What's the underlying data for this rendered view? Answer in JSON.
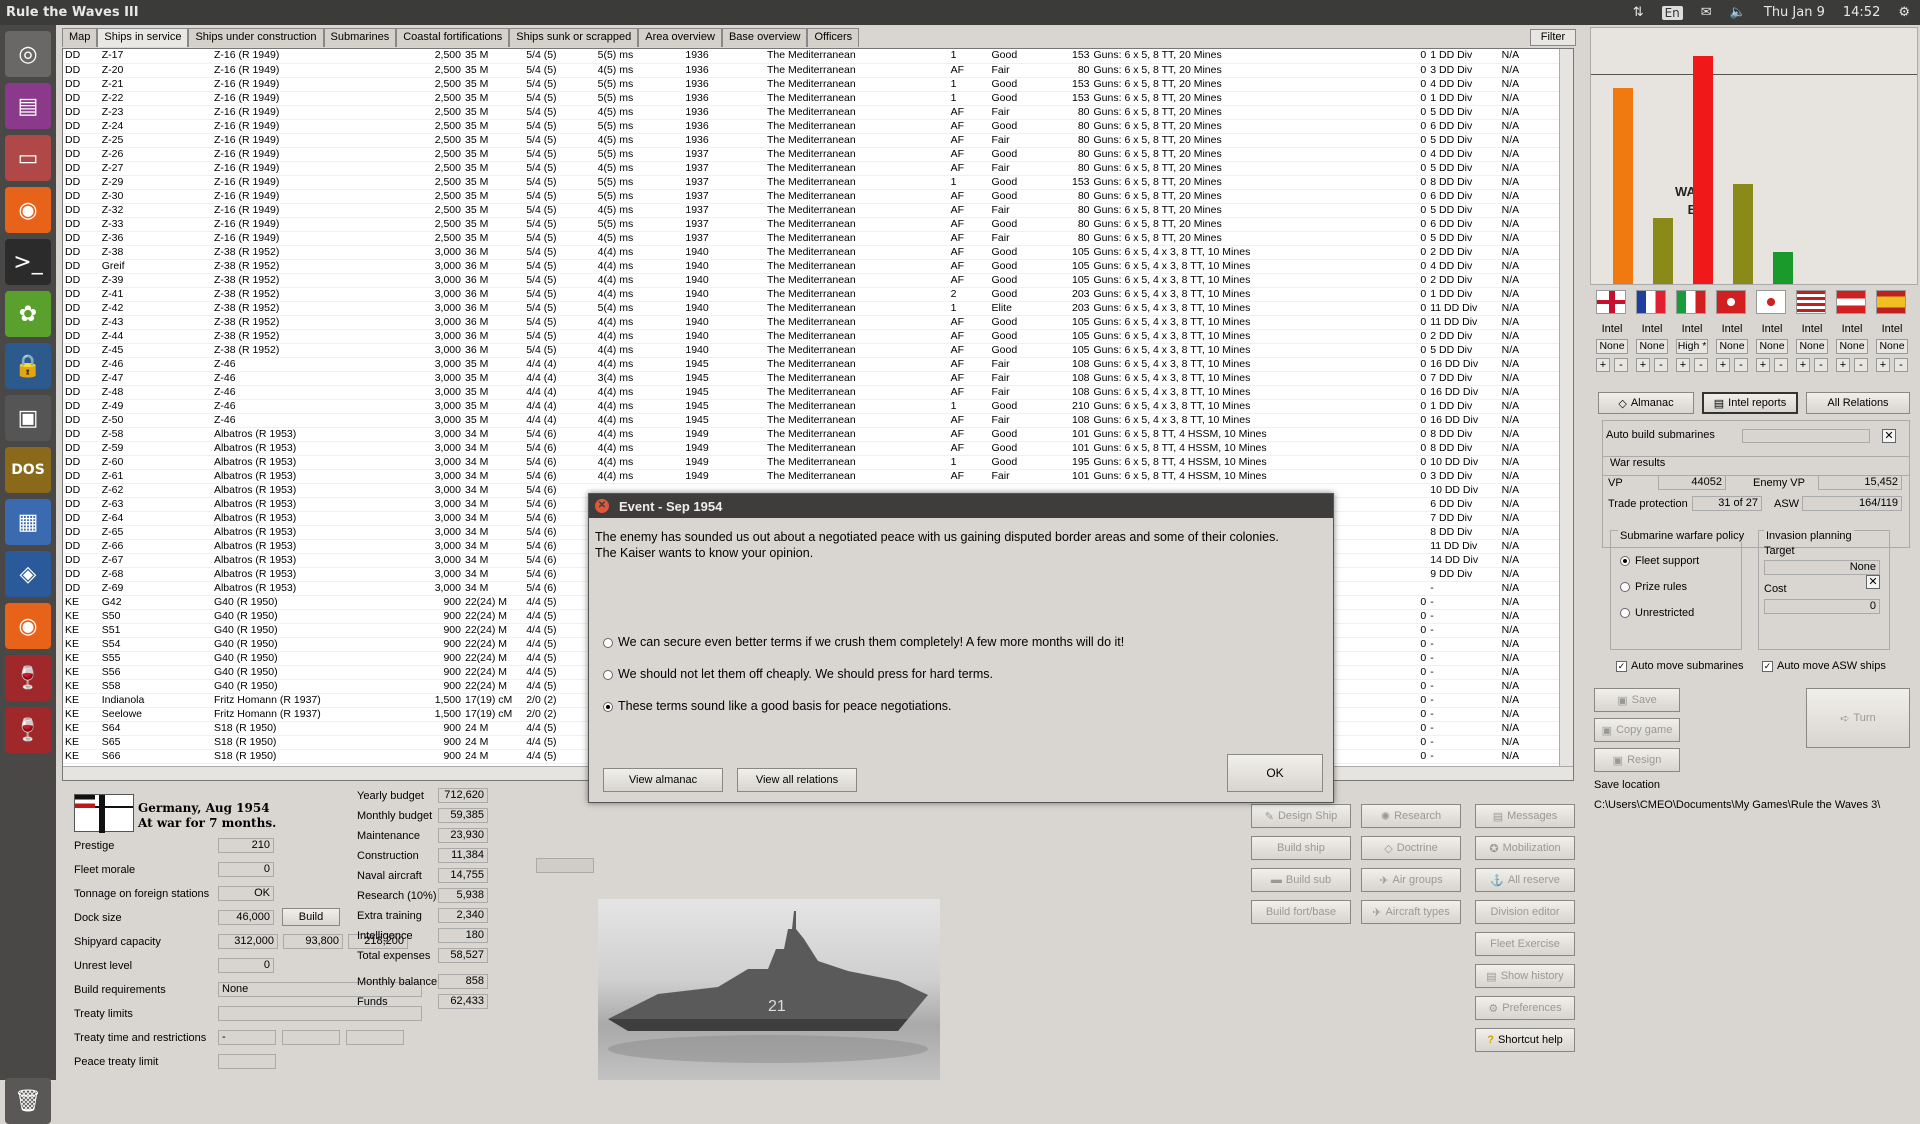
{
  "topbar": {
    "title": "Rule the Waves III",
    "lang": "En",
    "date": "Thu Jan 9",
    "time": "14:52"
  },
  "tabs": [
    "Map",
    "Ships in service",
    "Ships under construction",
    "Submarines",
    "Coastal fortifications",
    "Ships sunk or scrapped",
    "Area overview",
    "Base overview",
    "Officers"
  ],
  "filter_label": "Filter",
  "ships": [
    [
      "DD",
      "Z-17",
      "Z-16 (R 1949)",
      "2,500",
      "35 M",
      "5/4 (5)",
      "5(5) ms",
      "1936",
      "The Mediterranean",
      "1",
      "Good",
      "153",
      "Guns: 6 x 5, 8 TT, 20 Mines",
      "0",
      "1 DD Div",
      "N/A"
    ],
    [
      "DD",
      "Z-20",
      "Z-16 (R 1949)",
      "2,500",
      "35 M",
      "5/4 (5)",
      "4(5) ms",
      "1936",
      "The Mediterranean",
      "AF",
      "Fair",
      "80",
      "Guns: 6 x 5, 8 TT, 20 Mines",
      "0",
      "3 DD Div",
      "N/A"
    ],
    [
      "DD",
      "Z-21",
      "Z-16 (R 1949)",
      "2,500",
      "35 M",
      "5/4 (5)",
      "5(5) ms",
      "1936",
      "The Mediterranean",
      "1",
      "Good",
      "153",
      "Guns: 6 x 5, 8 TT, 20 Mines",
      "0",
      "4 DD Div",
      "N/A"
    ],
    [
      "DD",
      "Z-22",
      "Z-16 (R 1949)",
      "2,500",
      "35 M",
      "5/4 (5)",
      "5(5) ms",
      "1936",
      "The Mediterranean",
      "1",
      "Good",
      "153",
      "Guns: 6 x 5, 8 TT, 20 Mines",
      "0",
      "1 DD Div",
      "N/A"
    ],
    [
      "DD",
      "Z-23",
      "Z-16 (R 1949)",
      "2,500",
      "35 M",
      "5/4 (5)",
      "4(5) ms",
      "1936",
      "The Mediterranean",
      "AF",
      "Fair",
      "80",
      "Guns: 6 x 5, 8 TT, 20 Mines",
      "0",
      "5 DD Div",
      "N/A"
    ],
    [
      "DD",
      "Z-24",
      "Z-16 (R 1949)",
      "2,500",
      "35 M",
      "5/4 (5)",
      "5(5) ms",
      "1936",
      "The Mediterranean",
      "AF",
      "Good",
      "80",
      "Guns: 6 x 5, 8 TT, 20 Mines",
      "0",
      "6 DD Div",
      "N/A"
    ],
    [
      "DD",
      "Z-25",
      "Z-16 (R 1949)",
      "2,500",
      "35 M",
      "5/4 (5)",
      "4(5) ms",
      "1936",
      "The Mediterranean",
      "AF",
      "Fair",
      "80",
      "Guns: 6 x 5, 8 TT, 20 Mines",
      "0",
      "5 DD Div",
      "N/A"
    ],
    [
      "DD",
      "Z-26",
      "Z-16 (R 1949)",
      "2,500",
      "35 M",
      "5/4 (5)",
      "5(5) ms",
      "1937",
      "The Mediterranean",
      "AF",
      "Good",
      "80",
      "Guns: 6 x 5, 8 TT, 20 Mines",
      "0",
      "4 DD Div",
      "N/A"
    ],
    [
      "DD",
      "Z-27",
      "Z-16 (R 1949)",
      "2,500",
      "35 M",
      "5/4 (5)",
      "4(5) ms",
      "1937",
      "The Mediterranean",
      "AF",
      "Fair",
      "80",
      "Guns: 6 x 5, 8 TT, 20 Mines",
      "0",
      "5 DD Div",
      "N/A"
    ],
    [
      "DD",
      "Z-29",
      "Z-16 (R 1949)",
      "2,500",
      "35 M",
      "5/4 (5)",
      "5(5) ms",
      "1937",
      "The Mediterranean",
      "1",
      "Good",
      "153",
      "Guns: 6 x 5, 8 TT, 20 Mines",
      "0",
      "8 DD Div",
      "N/A"
    ],
    [
      "DD",
      "Z-30",
      "Z-16 (R 1949)",
      "2,500",
      "35 M",
      "5/4 (5)",
      "5(5) ms",
      "1937",
      "The Mediterranean",
      "AF",
      "Good",
      "80",
      "Guns: 6 x 5, 8 TT, 20 Mines",
      "0",
      "6 DD Div",
      "N/A"
    ],
    [
      "DD",
      "Z-32",
      "Z-16 (R 1949)",
      "2,500",
      "35 M",
      "5/4 (5)",
      "4(5) ms",
      "1937",
      "The Mediterranean",
      "AF",
      "Fair",
      "80",
      "Guns: 6 x 5, 8 TT, 20 Mines",
      "0",
      "5 DD Div",
      "N/A"
    ],
    [
      "DD",
      "Z-33",
      "Z-16 (R 1949)",
      "2,500",
      "35 M",
      "5/4 (5)",
      "5(5) ms",
      "1937",
      "The Mediterranean",
      "AF",
      "Good",
      "80",
      "Guns: 6 x 5, 8 TT, 20 Mines",
      "0",
      "6 DD Div",
      "N/A"
    ],
    [
      "DD",
      "Z-36",
      "Z-16 (R 1949)",
      "2,500",
      "35 M",
      "5/4 (5)",
      "4(5) ms",
      "1937",
      "The Mediterranean",
      "AF",
      "Fair",
      "80",
      "Guns: 6 x 5, 8 TT, 20 Mines",
      "0",
      "5 DD Div",
      "N/A"
    ],
    [
      "DD",
      "Z-38",
      "Z-38 (R 1952)",
      "3,000",
      "36 M",
      "5/4 (5)",
      "4(4) ms",
      "1940",
      "The Mediterranean",
      "AF",
      "Good",
      "105",
      "Guns: 6 x 5, 4 x 3, 8 TT, 10 Mines",
      "0",
      "2 DD Div",
      "N/A"
    ],
    [
      "DD",
      "Greif",
      "Z-38 (R 1952)",
      "3,000",
      "36 M",
      "5/4 (5)",
      "4(4) ms",
      "1940",
      "The Mediterranean",
      "AF",
      "Good",
      "105",
      "Guns: 6 x 5, 4 x 3, 8 TT, 10 Mines",
      "0",
      "4 DD Div",
      "N/A"
    ],
    [
      "DD",
      "Z-39",
      "Z-38 (R 1952)",
      "3,000",
      "36 M",
      "5/4 (5)",
      "4(4) ms",
      "1940",
      "The Mediterranean",
      "AF",
      "Good",
      "105",
      "Guns: 6 x 5, 4 x 3, 8 TT, 10 Mines",
      "0",
      "2 DD Div",
      "N/A"
    ],
    [
      "DD",
      "Z-41",
      "Z-38 (R 1952)",
      "3,000",
      "36 M",
      "5/4 (5)",
      "4(4) ms",
      "1940",
      "The Mediterranean",
      "2",
      "Good",
      "203",
      "Guns: 6 x 5, 4 x 3, 8 TT, 10 Mines",
      "0",
      "1 DD Div",
      "N/A"
    ],
    [
      "DD",
      "Z-42",
      "Z-38 (R 1952)",
      "3,000",
      "36 M",
      "5/4 (5)",
      "5(4) ms",
      "1940",
      "The Mediterranean",
      "1",
      "Elite",
      "203",
      "Guns: 6 x 5, 4 x 3, 8 TT, 10 Mines",
      "0",
      "11 DD Div",
      "N/A"
    ],
    [
      "DD",
      "Z-43",
      "Z-38 (R 1952)",
      "3,000",
      "36 M",
      "5/4 (5)",
      "4(4) ms",
      "1940",
      "The Mediterranean",
      "AF",
      "Good",
      "105",
      "Guns: 6 x 5, 4 x 3, 8 TT, 10 Mines",
      "0",
      "11 DD Div",
      "N/A"
    ],
    [
      "DD",
      "Z-44",
      "Z-38 (R 1952)",
      "3,000",
      "36 M",
      "5/4 (5)",
      "4(4) ms",
      "1940",
      "The Mediterranean",
      "AF",
      "Good",
      "105",
      "Guns: 6 x 5, 4 x 3, 8 TT, 10 Mines",
      "0",
      "2 DD Div",
      "N/A"
    ],
    [
      "DD",
      "Z-45",
      "Z-38 (R 1952)",
      "3,000",
      "36 M",
      "5/4 (5)",
      "4(4) ms",
      "1940",
      "The Mediterranean",
      "AF",
      "Good",
      "105",
      "Guns: 6 x 5, 4 x 3, 8 TT, 10 Mines",
      "0",
      "5 DD Div",
      "N/A"
    ],
    [
      "DD",
      "Z-46",
      "Z-46",
      "3,000",
      "35 M",
      "4/4 (4)",
      "4(4) ms",
      "1945",
      "The Mediterranean",
      "AF",
      "Fair",
      "108",
      "Guns: 6 x 5, 4 x 3, 8 TT, 10 Mines",
      "0",
      "16 DD Div",
      "N/A"
    ],
    [
      "DD",
      "Z-47",
      "Z-46",
      "3,000",
      "35 M",
      "4/4 (4)",
      "3(4) ms",
      "1945",
      "The Mediterranean",
      "AF",
      "Fair",
      "108",
      "Guns: 6 x 5, 4 x 3, 8 TT, 10 Mines",
      "0",
      "7 DD Div",
      "N/A"
    ],
    [
      "DD",
      "Z-48",
      "Z-46",
      "3,000",
      "35 M",
      "4/4 (4)",
      "4(4) ms",
      "1945",
      "The Mediterranean",
      "AF",
      "Fair",
      "108",
      "Guns: 6 x 5, 4 x 3, 8 TT, 10 Mines",
      "0",
      "16 DD Div",
      "N/A"
    ],
    [
      "DD",
      "Z-49",
      "Z-46",
      "3,000",
      "35 M",
      "4/4 (4)",
      "4(4) ms",
      "1945",
      "The Mediterranean",
      "1",
      "Good",
      "210",
      "Guns: 6 x 5, 4 x 3, 8 TT, 10 Mines",
      "0",
      "1 DD Div",
      "N/A"
    ],
    [
      "DD",
      "Z-50",
      "Z-46",
      "3,000",
      "35 M",
      "4/4 (4)",
      "4(4) ms",
      "1945",
      "The Mediterranean",
      "AF",
      "Fair",
      "108",
      "Guns: 6 x 5, 4 x 3, 8 TT, 10 Mines",
      "0",
      "16 DD Div",
      "N/A"
    ],
    [
      "DD",
      "Z-58",
      "Albatros (R 1953)",
      "3,000",
      "34 M",
      "5/4 (6)",
      "4(4) ms",
      "1949",
      "The Mediterranean",
      "AF",
      "Good",
      "101",
      "Guns: 6 x 5, 8 TT, 4 HSSM, 10 Mines",
      "0",
      "8 DD Div",
      "N/A"
    ],
    [
      "DD",
      "Z-59",
      "Albatros (R 1953)",
      "3,000",
      "34 M",
      "5/4 (6)",
      "4(4) ms",
      "1949",
      "The Mediterranean",
      "AF",
      "Good",
      "101",
      "Guns: 6 x 5, 8 TT, 4 HSSM, 10 Mines",
      "0",
      "8 DD Div",
      "N/A"
    ],
    [
      "DD",
      "Z-60",
      "Albatros (R 1953)",
      "3,000",
      "34 M",
      "5/4 (6)",
      "4(4) ms",
      "1949",
      "The Mediterranean",
      "1",
      "Good",
      "195",
      "Guns: 6 x 5, 8 TT, 4 HSSM, 10 Mines",
      "0",
      "10 DD Div",
      "N/A"
    ],
    [
      "DD",
      "Z-61",
      "Albatros (R 1953)",
      "3,000",
      "34 M",
      "5/4 (6)",
      "4(4) ms",
      "1949",
      "The Mediterranean",
      "AF",
      "Fair",
      "101",
      "Guns: 6 x 5, 8 TT, 4 HSSM, 10 Mines",
      "0",
      "3 DD Div",
      "N/A"
    ],
    [
      "DD",
      "Z-62",
      "Albatros (R 1953)",
      "3,000",
      "34 M",
      "5/4 (6)",
      "",
      "",
      "",
      "",
      "",
      "",
      "",
      "",
      "10 DD Div",
      "N/A"
    ],
    [
      "DD",
      "Z-63",
      "Albatros (R 1953)",
      "3,000",
      "34 M",
      "5/4 (6)",
      "",
      "",
      "",
      "",
      "",
      "",
      "",
      "",
      "6 DD Div",
      "N/A"
    ],
    [
      "DD",
      "Z-64",
      "Albatros (R 1953)",
      "3,000",
      "34 M",
      "5/4 (6)",
      "",
      "",
      "",
      "",
      "",
      "",
      "",
      "",
      "7 DD Div",
      "N/A"
    ],
    [
      "DD",
      "Z-65",
      "Albatros (R 1953)",
      "3,000",
      "34 M",
      "5/4 (6)",
      "",
      "",
      "",
      "",
      "",
      "",
      "",
      "",
      "8 DD Div",
      "N/A"
    ],
    [
      "DD",
      "Z-66",
      "Albatros (R 1953)",
      "3,000",
      "34 M",
      "5/4 (6)",
      "",
      "",
      "",
      "",
      "",
      "",
      "",
      "",
      "11 DD Div",
      "N/A"
    ],
    [
      "DD",
      "Z-67",
      "Albatros (R 1953)",
      "3,000",
      "34 M",
      "5/4 (6)",
      "",
      "",
      "",
      "",
      "",
      "",
      "",
      "",
      "14 DD Div",
      "N/A"
    ],
    [
      "DD",
      "Z-68",
      "Albatros (R 1953)",
      "3,000",
      "34 M",
      "5/4 (6)",
      "",
      "",
      "",
      "",
      "",
      "",
      "",
      "",
      "9 DD Div",
      "N/A"
    ],
    [
      "DD",
      "Z-69",
      "Albatros (R 1953)",
      "3,000",
      "34 M",
      "5/4 (6)",
      "",
      "",
      "",
      "",
      "",
      "",
      "",
      "",
      "-",
      "N/A"
    ],
    [
      "KE",
      "G42",
      "G40   (R 1950)",
      "900",
      "22(24) M",
      "4/4 (5)",
      "",
      "",
      "",
      "",
      "",
      "",
      "",
      "0",
      "-",
      "N/A"
    ],
    [
      "KE",
      "S50",
      "G40   (R 1950)",
      "900",
      "22(24) M",
      "4/4 (5)",
      "",
      "",
      "",
      "",
      "",
      "",
      "",
      "0",
      "-",
      "N/A"
    ],
    [
      "KE",
      "S51",
      "G40   (R 1950)",
      "900",
      "22(24) M",
      "4/4 (5)",
      "",
      "",
      "",
      "",
      "",
      "",
      "",
      "0",
      "-",
      "N/A"
    ],
    [
      "KE",
      "S54",
      "G40   (R 1950)",
      "900",
      "22(24) M",
      "4/4 (5)",
      "",
      "",
      "",
      "",
      "",
      "",
      "",
      "0",
      "-",
      "N/A"
    ],
    [
      "KE",
      "S55",
      "G40   (R 1950)",
      "900",
      "22(24) M",
      "4/4 (5)",
      "",
      "",
      "",
      "",
      "",
      "",
      "",
      "0",
      "-",
      "N/A"
    ],
    [
      "KE",
      "S56",
      "G40   (R 1950)",
      "900",
      "22(24) M",
      "4/4 (5)",
      "",
      "",
      "",
      "",
      "",
      "",
      "",
      "0",
      "-",
      "N/A"
    ],
    [
      "KE",
      "S58",
      "G40   (R 1950)",
      "900",
      "22(24) M",
      "4/4 (5)",
      "",
      "",
      "",
      "",
      "",
      "",
      "",
      "0",
      "-",
      "N/A"
    ],
    [
      "KE",
      "Indianola",
      "Fritz Homann  (R 1937)",
      "1,500",
      "17(19) cM",
      "2/0 (2)",
      "",
      "",
      "",
      "",
      "",
      "",
      "",
      "0",
      "-",
      "N/A"
    ],
    [
      "KE",
      "Seelowe",
      "Fritz Homann  (R 1937)",
      "1,500",
      "17(19) cM",
      "2/0 (2)",
      "",
      "",
      "",
      "",
      "",
      "",
      "",
      "0",
      "-",
      "N/A"
    ],
    [
      "KE",
      "S64",
      "S18   (R 1950)",
      "900",
      "24 M",
      "4/4 (5)",
      "",
      "",
      "",
      "",
      "",
      "",
      "",
      "0",
      "-",
      "N/A"
    ],
    [
      "KE",
      "S65",
      "S18   (R 1950)",
      "900",
      "24 M",
      "4/4 (5)",
      "",
      "",
      "",
      "",
      "",
      "",
      "",
      "0",
      "-",
      "N/A"
    ],
    [
      "KE",
      "S66",
      "S18   (R 1950)",
      "900",
      "24 M",
      "4/4 (5)",
      "",
      "",
      "",
      "",
      "",
      "",
      "",
      "0",
      "-",
      "N/A"
    ]
  ],
  "nation": {
    "title": "Germany, Aug 1954",
    "subtitle": "At war for 7 months."
  },
  "stats": {
    "prestige": {
      "label": "Prestige",
      "value": "210"
    },
    "morale": {
      "label": "Fleet morale",
      "value": "0"
    },
    "tonnage": {
      "label": "Tonnage on foreign stations",
      "value": "OK"
    },
    "dock": {
      "label": "Dock size",
      "value": "46,000",
      "button": "Build"
    },
    "shipyard": {
      "label": "Shipyard capacity",
      "v1": "312,000",
      "v2": "93,800",
      "v3": "218,200"
    },
    "unrest": {
      "label": "Unrest level",
      "value": "0"
    },
    "buildreq": {
      "label": "Build requirements",
      "value": "None"
    },
    "treaty": {
      "label": "Treaty limits",
      "value": ""
    },
    "treatytime": {
      "label": "Treaty time and restrictions",
      "value": "-"
    },
    "peacetreaty": {
      "label": "Peace treaty limit",
      "value": ""
    }
  },
  "budget": [
    {
      "label": "Yearly budget",
      "value": "712,620"
    },
    {
      "label": "Monthly budget",
      "value": "59,385"
    },
    {
      "label": "Maintenance",
      "value": "23,930"
    },
    {
      "label": "Construction",
      "value": "11,384"
    },
    {
      "label": "Naval aircraft",
      "value": "14,755"
    },
    {
      "label": "Research (10%)",
      "value": "5,938"
    },
    {
      "label": "Extra training",
      "value": "2,340"
    },
    {
      "label": "Intelligence",
      "value": "180"
    },
    {
      "label": "Total expenses",
      "value": "58,527"
    },
    {
      "label": "Monthly balance",
      "value": "858"
    },
    {
      "label": "Funds",
      "value": "62,433"
    }
  ],
  "ship_hull_number": "21",
  "bottom_buttons": {
    "design_ship": "Design Ship",
    "research": "Research",
    "messages": "Messages",
    "build_ship": "Build ship",
    "doctrine": "Doctrine",
    "mobilization": "Mobilization",
    "build_sub": "Build sub",
    "air_groups": "Air groups",
    "all_reserve": "All reserve",
    "build_fort": "Build fort/base",
    "aircraft_types": "Aircraft types",
    "division_editor": "Division editor",
    "fleet_exercise": "Fleet Exercise",
    "show_history": "Show history",
    "preferences": "Preferences",
    "shortcut_help": "Shortcut help"
  },
  "war_chart": {
    "label_war": "WAR!",
    "label_b": "B",
    "bars": [
      {
        "value": 0.86,
        "color": "#f07a10"
      },
      {
        "value": 0.29,
        "color": "#8a8a18"
      },
      {
        "value": 1.0,
        "color": "#f01818"
      },
      {
        "value": 0.44,
        "color": "#8a8a18"
      },
      {
        "value": 0.14,
        "color": "#1a9a2a"
      }
    ]
  },
  "intel": {
    "label": "Intel",
    "values": [
      "None",
      "None",
      "High *",
      "None",
      "None",
      "None",
      "None",
      "None"
    ]
  },
  "right_buttons": {
    "almanac": "Almanac",
    "intel_reports": "Intel reports",
    "all_relations": "All Relations"
  },
  "auto_build_subs": "Auto build submarines",
  "war_results": {
    "title": "War results",
    "vp_label": "VP",
    "vp": "44052",
    "enemy_vp_label": "Enemy VP",
    "enemy_vp": "15,452",
    "trade_label": "Trade protection",
    "trade": "31 of 27",
    "asw_label": "ASW",
    "asw": "164/119"
  },
  "sub_policy": {
    "title": "Submarine warfare policy",
    "options": [
      "Fleet support",
      "Prize rules",
      "Unrestricted"
    ]
  },
  "invasion": {
    "title": "Invasion planning",
    "target_label": "Target",
    "target": "None",
    "cost_label": "Cost",
    "cost": "0"
  },
  "auto_move_subs": "Auto move submarines",
  "auto_move_asw": "Auto move ASW ships",
  "save": {
    "save": "Save",
    "copy": "Copy game",
    "resign": "Resign",
    "turn": "Turn",
    "location_label": "Save location",
    "location": "C:\\Users\\CMEO\\Documents\\My Games\\Rule the Waves 3\\"
  },
  "dialog": {
    "title": "Event - Sep 1954",
    "text": "The enemy has sounded us out about a negotiated peace with us gaining disputed border areas and some of their colonies. The Kaiser wants to know your opinion.",
    "options": [
      "We can secure even better terms if we crush them completely! A few more months will do it!",
      "We should not let them off cheaply. We should press for hard terms.",
      "These terms sound like a good basis for peace negotiations."
    ],
    "view_almanac": "View almanac",
    "view_relations": "View all relations",
    "ok": "OK"
  }
}
